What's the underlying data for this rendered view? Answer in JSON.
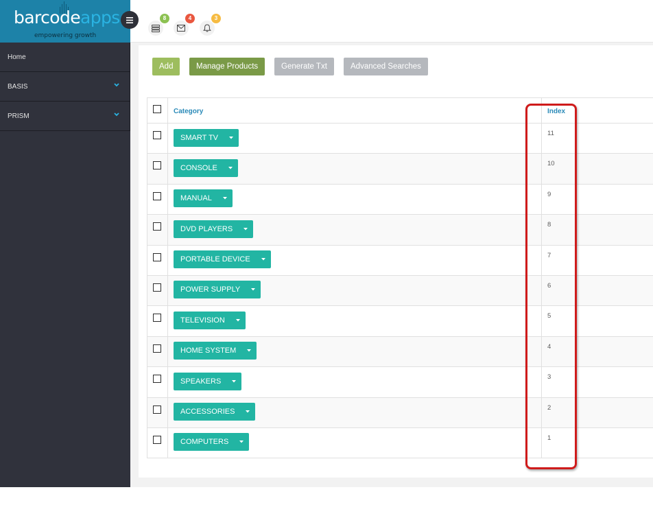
{
  "logo": {
    "part1": "barcode",
    "part2": "apps",
    "tagline": "empowering growth"
  },
  "header": {
    "icons": [
      {
        "name": "server-icon",
        "badge": "8",
        "badge_color": "#8cc152"
      },
      {
        "name": "envelope-icon",
        "badge": "4",
        "badge_color": "#e9573f"
      },
      {
        "name": "bell-icon",
        "badge": "3",
        "badge_color": "#f6bb42"
      }
    ]
  },
  "sidebar": {
    "items": [
      {
        "label": "Home",
        "expandable": false
      },
      {
        "label": "BASIS",
        "expandable": true
      },
      {
        "label": "PRISM",
        "expandable": true
      }
    ]
  },
  "toolbar": {
    "add_label": "Add",
    "manage_label": "Manage Products",
    "generate_label": "Generate Txt",
    "advanced_label": "Advanced Searches"
  },
  "table": {
    "headers": {
      "category": "Category",
      "index": "Index"
    },
    "rows": [
      {
        "category": "SMART TV",
        "index": "11"
      },
      {
        "category": "CONSOLE",
        "index": "10"
      },
      {
        "category": "MANUAL",
        "index": "9"
      },
      {
        "category": "DVD PLAYERS",
        "index": "8"
      },
      {
        "category": "PORTABLE DEVICE",
        "index": "7"
      },
      {
        "category": "POWER SUPPLY",
        "index": "6"
      },
      {
        "category": "TELEVISION",
        "index": "5"
      },
      {
        "category": "HOME SYSTEM",
        "index": "4"
      },
      {
        "category": "SPEAKERS",
        "index": "3"
      },
      {
        "category": "ACCESSORIES",
        "index": "2"
      },
      {
        "category": "COMPUTERS",
        "index": "1"
      }
    ]
  },
  "colors": {
    "sidebar_bg": "#30323c",
    "logo_bg": "#1d82a8",
    "category_button": "#22b5a3",
    "add_button": "#9dbd5e",
    "manage_button": "#7a9a47",
    "grey_button": "#b5b8bd",
    "highlight": "#cf1b1b"
  }
}
